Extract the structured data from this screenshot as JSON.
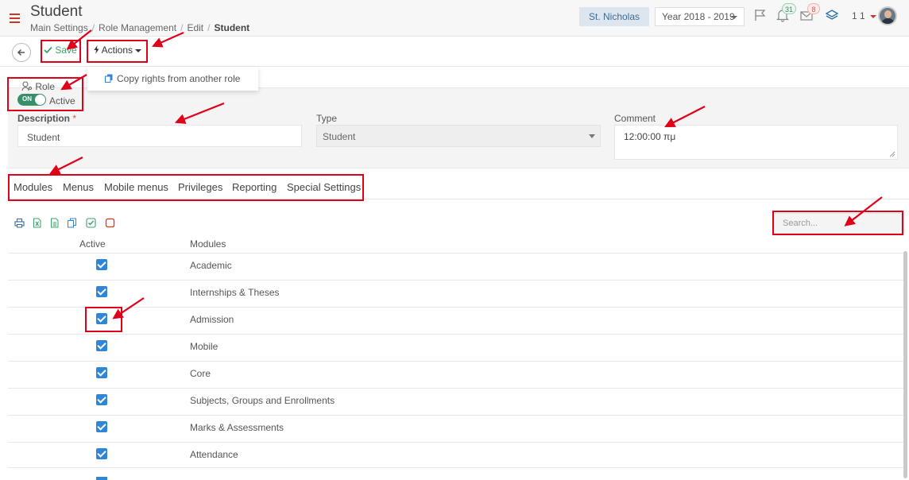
{
  "header": {
    "title": "Student",
    "breadcrumb": [
      "Main Settings",
      "Role Management",
      "Edit",
      "Student"
    ],
    "school": "St. Nicholas",
    "year": "Year 2018 - 2019",
    "notifications_count": "31",
    "messages_count": "8",
    "user_label": "1 1",
    "icons": [
      "menu-icon",
      "flag-icon",
      "bell-icon",
      "envelope-icon",
      "layers-icon",
      "user-avatar"
    ],
    "accent_color": "#c0392b"
  },
  "toolbar": {
    "back_icon": "arrow-left-icon",
    "save_label": "Save",
    "actions_label": "Actions",
    "actions_menu": [
      "Copy rights from another role"
    ]
  },
  "role": {
    "label": "Role",
    "toggle_text": "ON",
    "active_label": "Active",
    "toggle_color": "#3a8f6b"
  },
  "form": {
    "description_label": "Description",
    "required_mark": "*",
    "description_value": "Student",
    "type_label": "Type",
    "type_value": "Student",
    "comment_label": "Comment",
    "comment_value": "12:00:00 πμ"
  },
  "tabs": [
    "Modules",
    "Menus",
    "Mobile menus",
    "Privileges",
    "Reporting",
    "Special Settings"
  ],
  "table": {
    "tool_icons": [
      "print-icon",
      "excel-icon",
      "csv-icon",
      "copy-icon",
      "check-all-icon",
      "uncheck-all-icon"
    ],
    "search_placeholder": "Search...",
    "columns": [
      "Active",
      "Modules"
    ],
    "rows": [
      {
        "active": true,
        "module": "Academic"
      },
      {
        "active": true,
        "module": "Internships & Theses"
      },
      {
        "active": true,
        "module": "Admission"
      },
      {
        "active": true,
        "module": "Mobile"
      },
      {
        "active": true,
        "module": "Core"
      },
      {
        "active": true,
        "module": "Subjects, Groups and Enrollments"
      },
      {
        "active": true,
        "module": "Marks & Assessments"
      },
      {
        "active": true,
        "module": "Attendance"
      }
    ],
    "checkbox_color": "#2f86d6"
  },
  "annotation_color": "#e0001a"
}
